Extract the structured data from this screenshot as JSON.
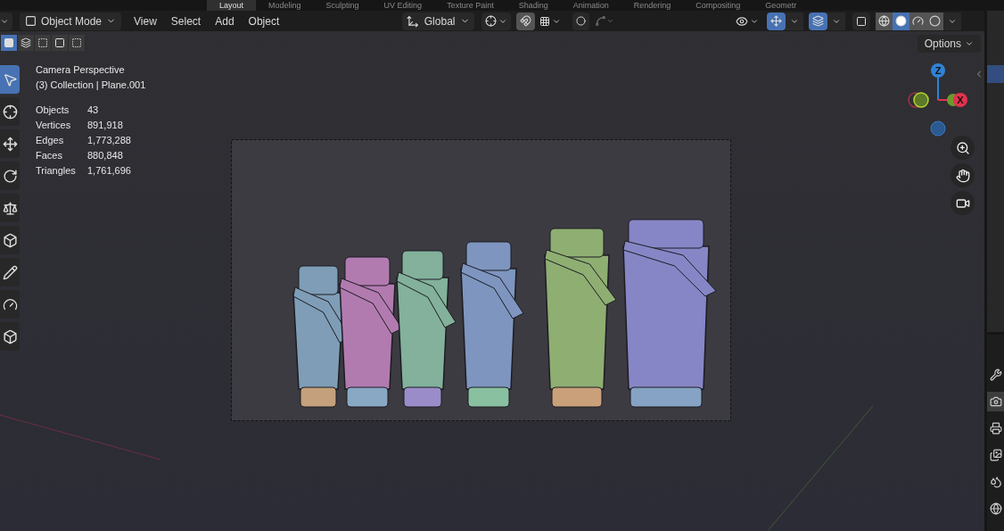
{
  "workspace_tabs": [
    {
      "label": "Layout",
      "selected": true
    },
    {
      "label": "Modeling",
      "selected": false
    },
    {
      "label": "Sculpting",
      "selected": false
    },
    {
      "label": "UV Editing",
      "selected": false
    },
    {
      "label": "Texture Paint",
      "selected": false
    },
    {
      "label": "Shading",
      "selected": false
    },
    {
      "label": "Animation",
      "selected": false
    },
    {
      "label": "Rendering",
      "selected": false
    },
    {
      "label": "Compositing",
      "selected": false
    },
    {
      "label": "Geometr",
      "selected": false
    }
  ],
  "header": {
    "mode": "Object Mode",
    "menus": [
      "View",
      "Select",
      "Add",
      "Object"
    ],
    "orientation": "Global",
    "snap_on": true,
    "proportional_on": false,
    "gizmos_on": true,
    "overlays_on": true,
    "xray_on": false,
    "shading": [
      {
        "kind": "wireframe",
        "selected": false
      },
      {
        "kind": "solid",
        "selected": true
      },
      {
        "kind": "material",
        "selected": false
      },
      {
        "kind": "rendered",
        "selected": false
      }
    ]
  },
  "selection_modes": [
    {
      "kind": "set",
      "selected": true
    },
    {
      "kind": "extend",
      "selected": false
    },
    {
      "kind": "subtract",
      "selected": false
    },
    {
      "kind": "invert",
      "selected": false
    },
    {
      "kind": "intersect",
      "selected": false
    }
  ],
  "options_button": "Options",
  "tools": [
    {
      "kind": "select",
      "selected": true
    },
    {
      "kind": "cursor",
      "selected": false
    },
    {
      "kind": "move",
      "selected": false
    },
    {
      "kind": "rotate",
      "selected": false
    },
    {
      "kind": "scale",
      "selected": false
    },
    {
      "kind": "transform",
      "selected": false
    },
    {
      "kind": "annotate",
      "selected": false
    },
    {
      "kind": "measure",
      "selected": false
    },
    {
      "kind": "add-cube",
      "selected": false
    }
  ],
  "overlay_info": {
    "view": "Camera Perspective",
    "context": "(3) Collection | Plane.001",
    "stats": [
      {
        "label": "Objects",
        "value": "43"
      },
      {
        "label": "Vertices",
        "value": "891,918"
      },
      {
        "label": "Edges",
        "value": "1,773,288"
      },
      {
        "label": "Faces",
        "value": "880,848"
      },
      {
        "label": "Triangles",
        "value": "1,761,696"
      }
    ]
  },
  "gizmo": {
    "axes": [
      {
        "label": "Z",
        "color": "#2e83d6"
      },
      {
        "label": "X",
        "color": "#e2324e"
      }
    ]
  },
  "navigation": [
    {
      "kind": "zoom"
    },
    {
      "kind": "pan"
    },
    {
      "kind": "camera"
    }
  ],
  "properties_tabs": [
    {
      "kind": "tool",
      "selected": false
    },
    {
      "kind": "render",
      "selected": true
    },
    {
      "kind": "output",
      "selected": false
    },
    {
      "kind": "view-layer",
      "selected": false
    },
    {
      "kind": "scene",
      "selected": false
    },
    {
      "kind": "world",
      "selected": false
    }
  ]
}
